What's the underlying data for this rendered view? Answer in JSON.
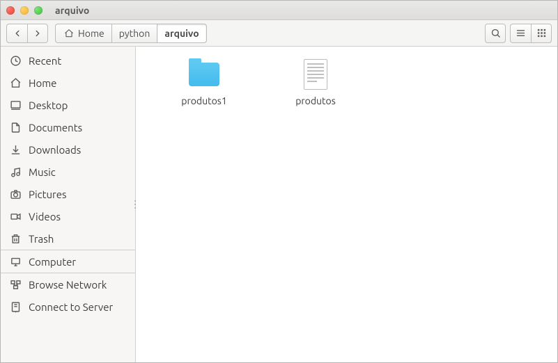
{
  "window": {
    "title": "arquivo"
  },
  "breadcrumbs": [
    {
      "label": "Home",
      "icon": "home-icon",
      "active": false
    },
    {
      "label": "python",
      "icon": null,
      "active": false
    },
    {
      "label": "arquivo",
      "icon": null,
      "active": true
    }
  ],
  "toolbar": {
    "back": "‹",
    "forward": "›",
    "search_icon": "search-icon",
    "menu_icon": "hamburger-icon",
    "view_icon": "grid-icon"
  },
  "sidebar": {
    "items": [
      {
        "icon": "clock-icon",
        "label": "Recent"
      },
      {
        "icon": "home-icon",
        "label": "Home"
      },
      {
        "icon": "desktop-icon",
        "label": "Desktop"
      },
      {
        "icon": "document-icon",
        "label": "Documents"
      },
      {
        "icon": "download-icon",
        "label": "Downloads"
      },
      {
        "icon": "music-icon",
        "label": "Music"
      },
      {
        "icon": "camera-icon",
        "label": "Pictures"
      },
      {
        "icon": "video-icon",
        "label": "Videos"
      },
      {
        "icon": "trash-icon",
        "label": "Trash"
      }
    ],
    "devices": [
      {
        "icon": "computer-icon",
        "label": "Computer"
      }
    ],
    "network": [
      {
        "icon": "browse-network-icon",
        "label": "Browse Network"
      },
      {
        "icon": "connect-server-icon",
        "label": "Connect to Server"
      }
    ]
  },
  "files": [
    {
      "type": "folder",
      "label": "produtos1"
    },
    {
      "type": "text",
      "label": "produtos"
    }
  ],
  "colors": {
    "folder": "#43bbed",
    "sidebar_bg": "#f7f6f5"
  }
}
